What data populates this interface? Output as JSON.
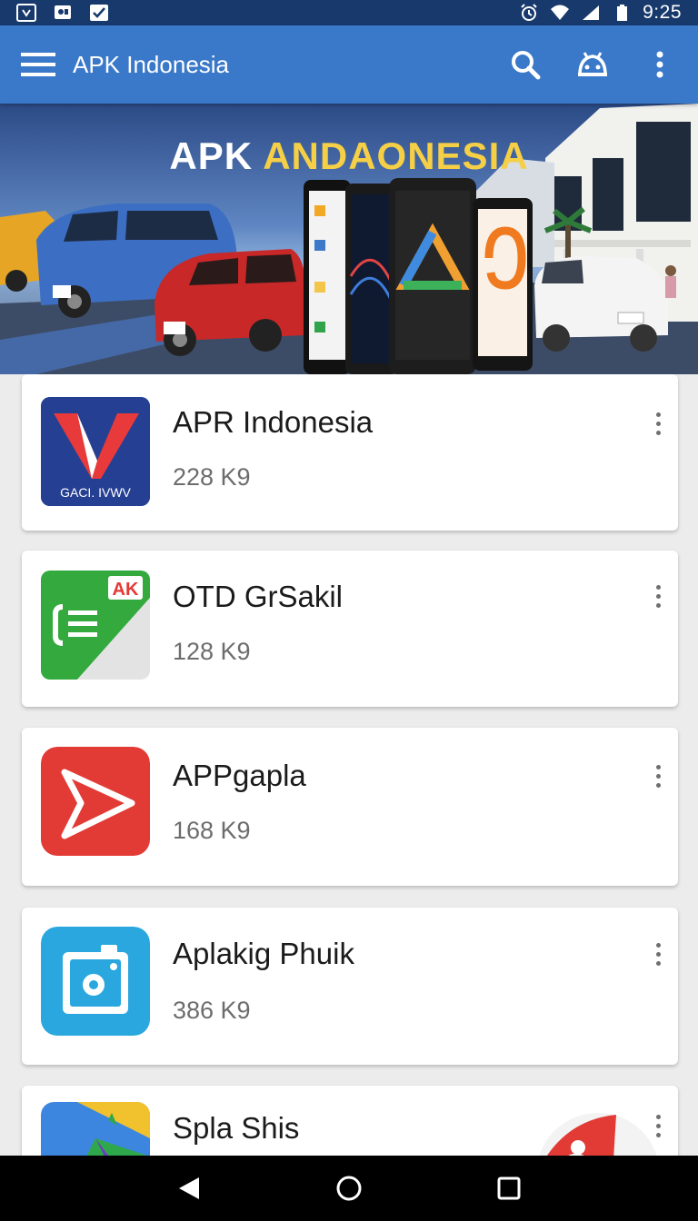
{
  "status_bar": {
    "time": "9:25",
    "icons": [
      "download-icon",
      "gallery-icon",
      "check-icon",
      "alarm-icon",
      "wifi-icon",
      "signal-icon",
      "battery-icon"
    ]
  },
  "app_bar": {
    "title": "APK Indonesia",
    "color": "#3a78c9",
    "icons": [
      "menu-icon",
      "search-icon",
      "android-icon",
      "more-vert-icon"
    ]
  },
  "banner": {
    "title_part1": "APK ",
    "title_part2": "ANDAONESIA"
  },
  "apps": [
    {
      "name": "APR Indonesia",
      "size": "228 K9",
      "icon": "v-logo-icon",
      "icon_text": "GACI. IVWV"
    },
    {
      "name": "OTD GrSakil",
      "size": "128 K9",
      "icon": "green-doc-icon",
      "icon_text": "AK"
    },
    {
      "name": "APPgapla",
      "size": "168 K9",
      "icon": "play-arrow-icon"
    },
    {
      "name": "Aplakig Phuik",
      "size": "386 K9",
      "icon": "camera-icon"
    },
    {
      "name": "Spla Shis",
      "size": "",
      "icon": "map-icon"
    }
  ],
  "nav_bar": {
    "icons": [
      "back-icon",
      "home-icon",
      "recents-icon"
    ]
  }
}
